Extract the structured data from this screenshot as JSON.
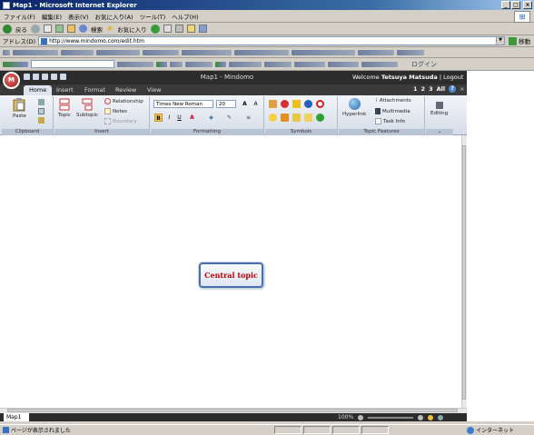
{
  "window": {
    "title": "Map1 - Microsoft Internet Explorer"
  },
  "ie_menu": [
    "ファイル(F)",
    "編集(E)",
    "表示(V)",
    "お気に入り(A)",
    "ツール(T)",
    "ヘルプ(H)"
  ],
  "ie_toolbar": {
    "back": "戻る",
    "search": "検索",
    "favorites": "お気に入り"
  },
  "address": {
    "label": "アドレス(D)",
    "url": "http://www.mindomo.com/edit.htm",
    "go": "移動"
  },
  "toolbar3": {
    "login": "ログイン"
  },
  "app": {
    "title": "Map1 - Mindomo",
    "welcome_prefix": "Welcome",
    "user": "Tetsuya Matsuda",
    "logout": "Logout",
    "tabs": [
      "Home",
      "Insert",
      "Format",
      "Review",
      "View"
    ],
    "pages": [
      "1",
      "2",
      "3",
      "All"
    ]
  },
  "ribbon": {
    "clipboard": {
      "paste": "Paste",
      "label": "Clipboard"
    },
    "insert": {
      "topic": "Topic",
      "subtopic": "Subtopic",
      "relationship": "Relationship",
      "notes": "Notes",
      "boundary": "Boundary",
      "label": "Insert"
    },
    "formatting": {
      "font": "Times New Roman",
      "size": "20",
      "bold": "B",
      "italic": "I",
      "underline": "U",
      "label": "Formatting"
    },
    "symbols": {
      "label": "Symbols"
    },
    "topic_features": {
      "hyperlink": "Hyperlink",
      "attachments": "Attachments",
      "multimedia": "Multimedia",
      "task_info": "Task Info",
      "label": "Topic Features"
    },
    "editing": {
      "label": "Editing"
    }
  },
  "canvas": {
    "central_topic": "Central topic"
  },
  "sheet": {
    "tab": "Map1",
    "zoom": "100%"
  },
  "status": {
    "message": "ページが表示されました",
    "zone": "インターネット"
  },
  "colors": {
    "accent": "#4a6fa8",
    "topic_text": "#c00000",
    "dark_bar": "#2c2c2c"
  }
}
